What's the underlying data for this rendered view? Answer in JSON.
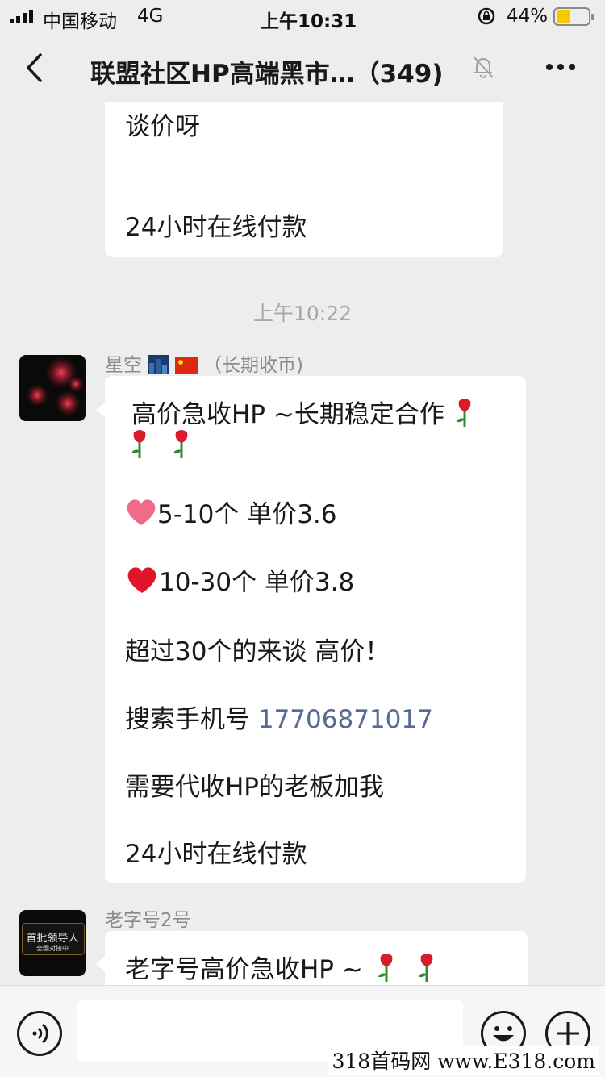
{
  "status_bar": {
    "carrier": "中国移动",
    "network": "4G",
    "time": "上午10:31",
    "battery": "44%"
  },
  "nav": {
    "title": "联盟社区HP高端黑市…（349)"
  },
  "chat": {
    "prev_message": {
      "lines": [
        "谈价呀",
        "24小时在线付款"
      ]
    },
    "timestamp": "上午10:22",
    "msg1": {
      "sender": "星空",
      "sender_suffix": "（长期收币)",
      "line1": "高价急收HP ~长期稳定合作",
      "line2": "5-10个 单价3.6",
      "line3": "10-30个 单价3.8",
      "line4": "超过30个的来谈 高价！",
      "line5_prefix": "搜索手机号 ",
      "line5_phone": "17706871017",
      "line6": "需要代收HP的老板加我",
      "line7": "24小时在线付款"
    },
    "msg2": {
      "sender": "老字号2号",
      "avatar_text_1": "首批领导人",
      "avatar_text_2": "全国对接中",
      "line1": "老字号高价急收HP ~"
    }
  },
  "colors": {
    "background": "#ededed",
    "bubble": "#ffffff",
    "link": "#576b95",
    "battery": "#f4c900"
  },
  "watermark": "318首码网 www.E318.com"
}
